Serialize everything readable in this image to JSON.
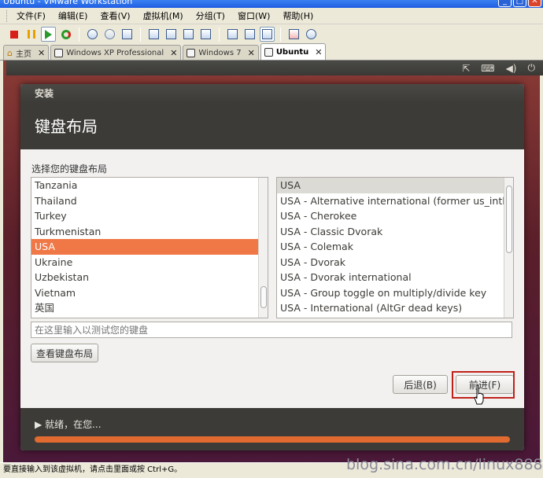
{
  "window": {
    "title": "Ubuntu - VMware Workstation"
  },
  "menu": [
    "文件(F)",
    "编辑(E)",
    "查看(V)",
    "虚拟机(M)",
    "分组(T)",
    "窗口(W)",
    "帮助(H)"
  ],
  "tabs": [
    {
      "label": "主页",
      "active": false
    },
    {
      "label": "Windows XP Professional",
      "active": false
    },
    {
      "label": "Windows 7",
      "active": false
    },
    {
      "label": "Ubuntu",
      "active": true
    }
  ],
  "installer": {
    "window_title": "安装",
    "heading": "键盘布局",
    "section_label": "选择您的键盘布局",
    "countries": [
      "Tanzania",
      "Thailand",
      "Turkey",
      "Turkmenistan",
      "USA",
      "Ukraine",
      "Uzbekistan",
      "Vietnam",
      "英国"
    ],
    "selected_country": "USA",
    "variants": [
      "USA",
      "USA - Alternative international (former us_intl)",
      "USA - Cherokee",
      "USA - Classic Dvorak",
      "USA - Colemak",
      "USA - Dvorak",
      "USA - Dvorak international",
      "USA - Group toggle on multiply/divide key",
      "USA - International (AltGr dead keys)"
    ],
    "selected_variant": "USA",
    "test_placeholder": "在这里输入以测试您的键盘",
    "detect_button": "查看键盘布局",
    "back_button": "后退(B)",
    "forward_button": "前进(F)",
    "status": "就绪，在您...",
    "status_arrow": "▶"
  },
  "host_status": "要直接输入到该虚拟机，请点击里面或按 Ctrl+G。",
  "watermark": "blog.sina.com.cn/linux888",
  "colors": {
    "accent": "#f07746",
    "header_bg": "#3c3b37",
    "highlight_box": "#c0211a"
  }
}
